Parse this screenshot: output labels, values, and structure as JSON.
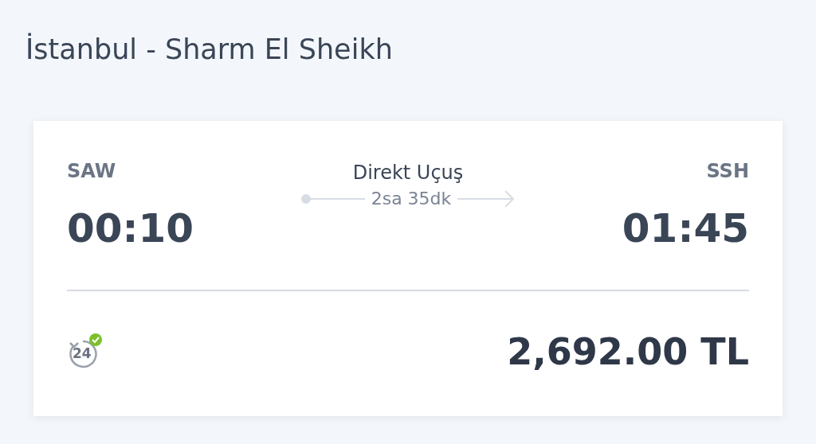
{
  "title": "İstanbul - Sharm El Sheikh",
  "flight": {
    "origin": {
      "code": "SAW",
      "time": "00:10"
    },
    "route": {
      "type": "Direkt Uçuş",
      "duration": "2sa 35dk"
    },
    "destination": {
      "code": "SSH",
      "time": "01:45"
    }
  },
  "footer": {
    "badge": "24",
    "price": "2,692.00 TL"
  }
}
